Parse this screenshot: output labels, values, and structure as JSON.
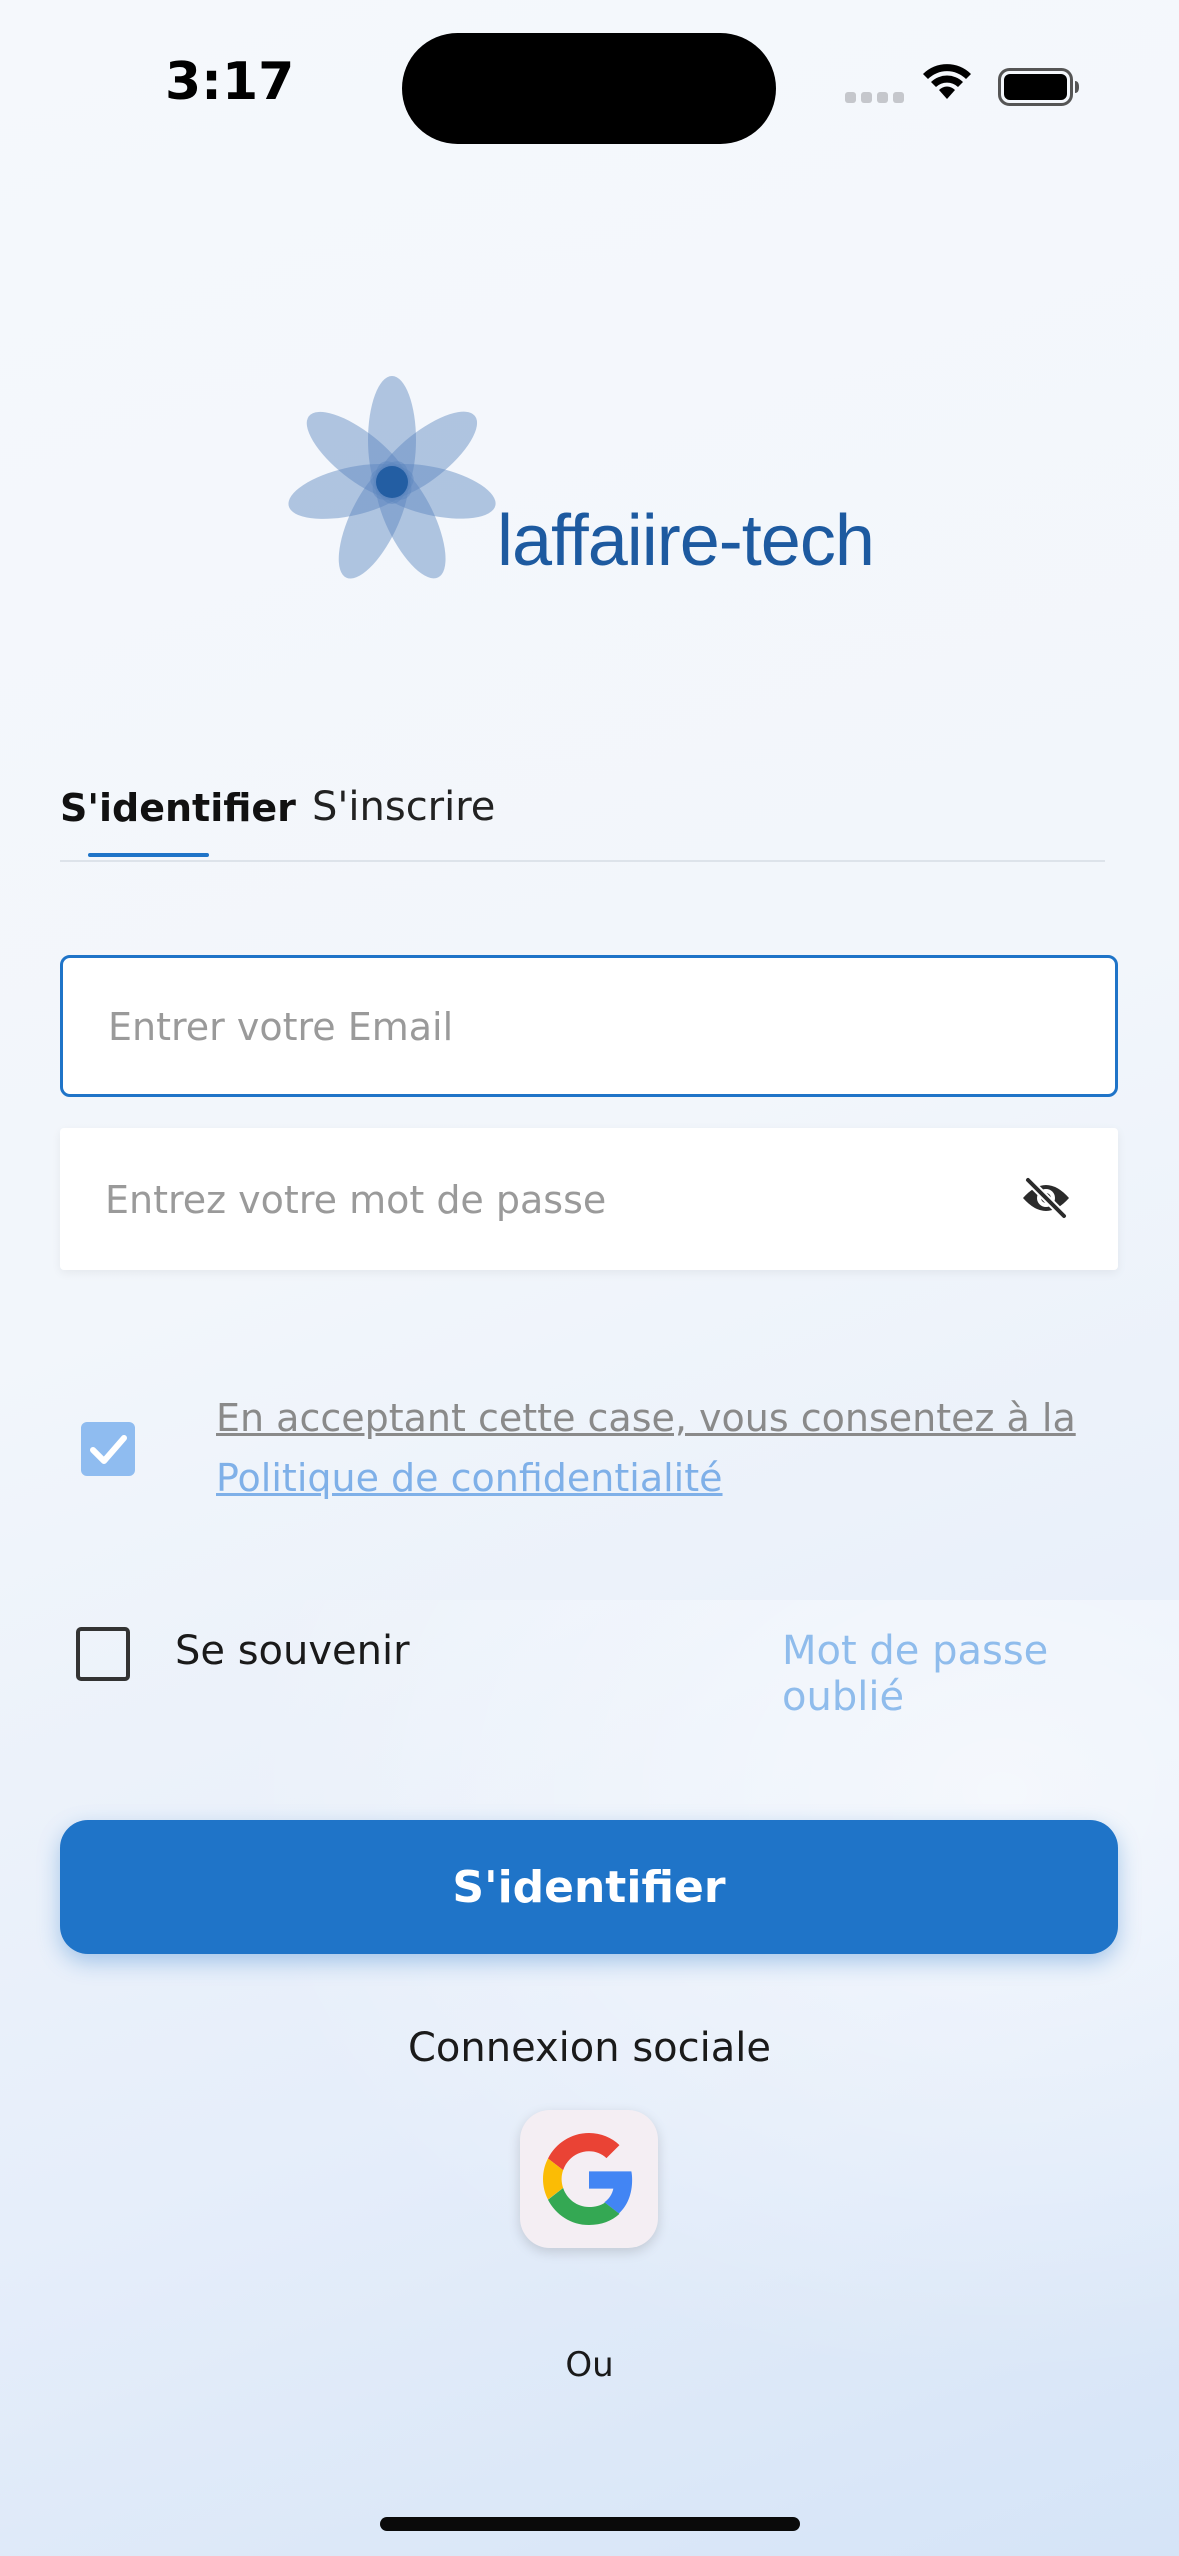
{
  "status_bar": {
    "time": "3:17"
  },
  "brand": {
    "name": "laffaiire-tech",
    "color": "#1d5aa0"
  },
  "tabs": {
    "login": "S'identifier",
    "register": "S'inscrire",
    "active": "login"
  },
  "form": {
    "email_placeholder": "Entrer votre Email",
    "email_value": "",
    "password_placeholder": "Entrez votre mot de passe",
    "password_value": "",
    "password_toggle_icon": "eye-off-icon"
  },
  "consent": {
    "checked": true,
    "text": "En acceptant cette case, vous consentez à la",
    "link": "Politique de confidentialité"
  },
  "remember": {
    "label": "Se souvenir",
    "checked": false
  },
  "forgot_password": "Mot de passe oublié",
  "submit_label": "S'identifier",
  "social": {
    "label": "Connexion sociale",
    "providers": [
      "google-icon"
    ]
  },
  "or_label": "Ou",
  "colors": {
    "accent": "#1f74c8",
    "link": "#8fbcec",
    "checkbox_checked": "#8fbcf0"
  }
}
